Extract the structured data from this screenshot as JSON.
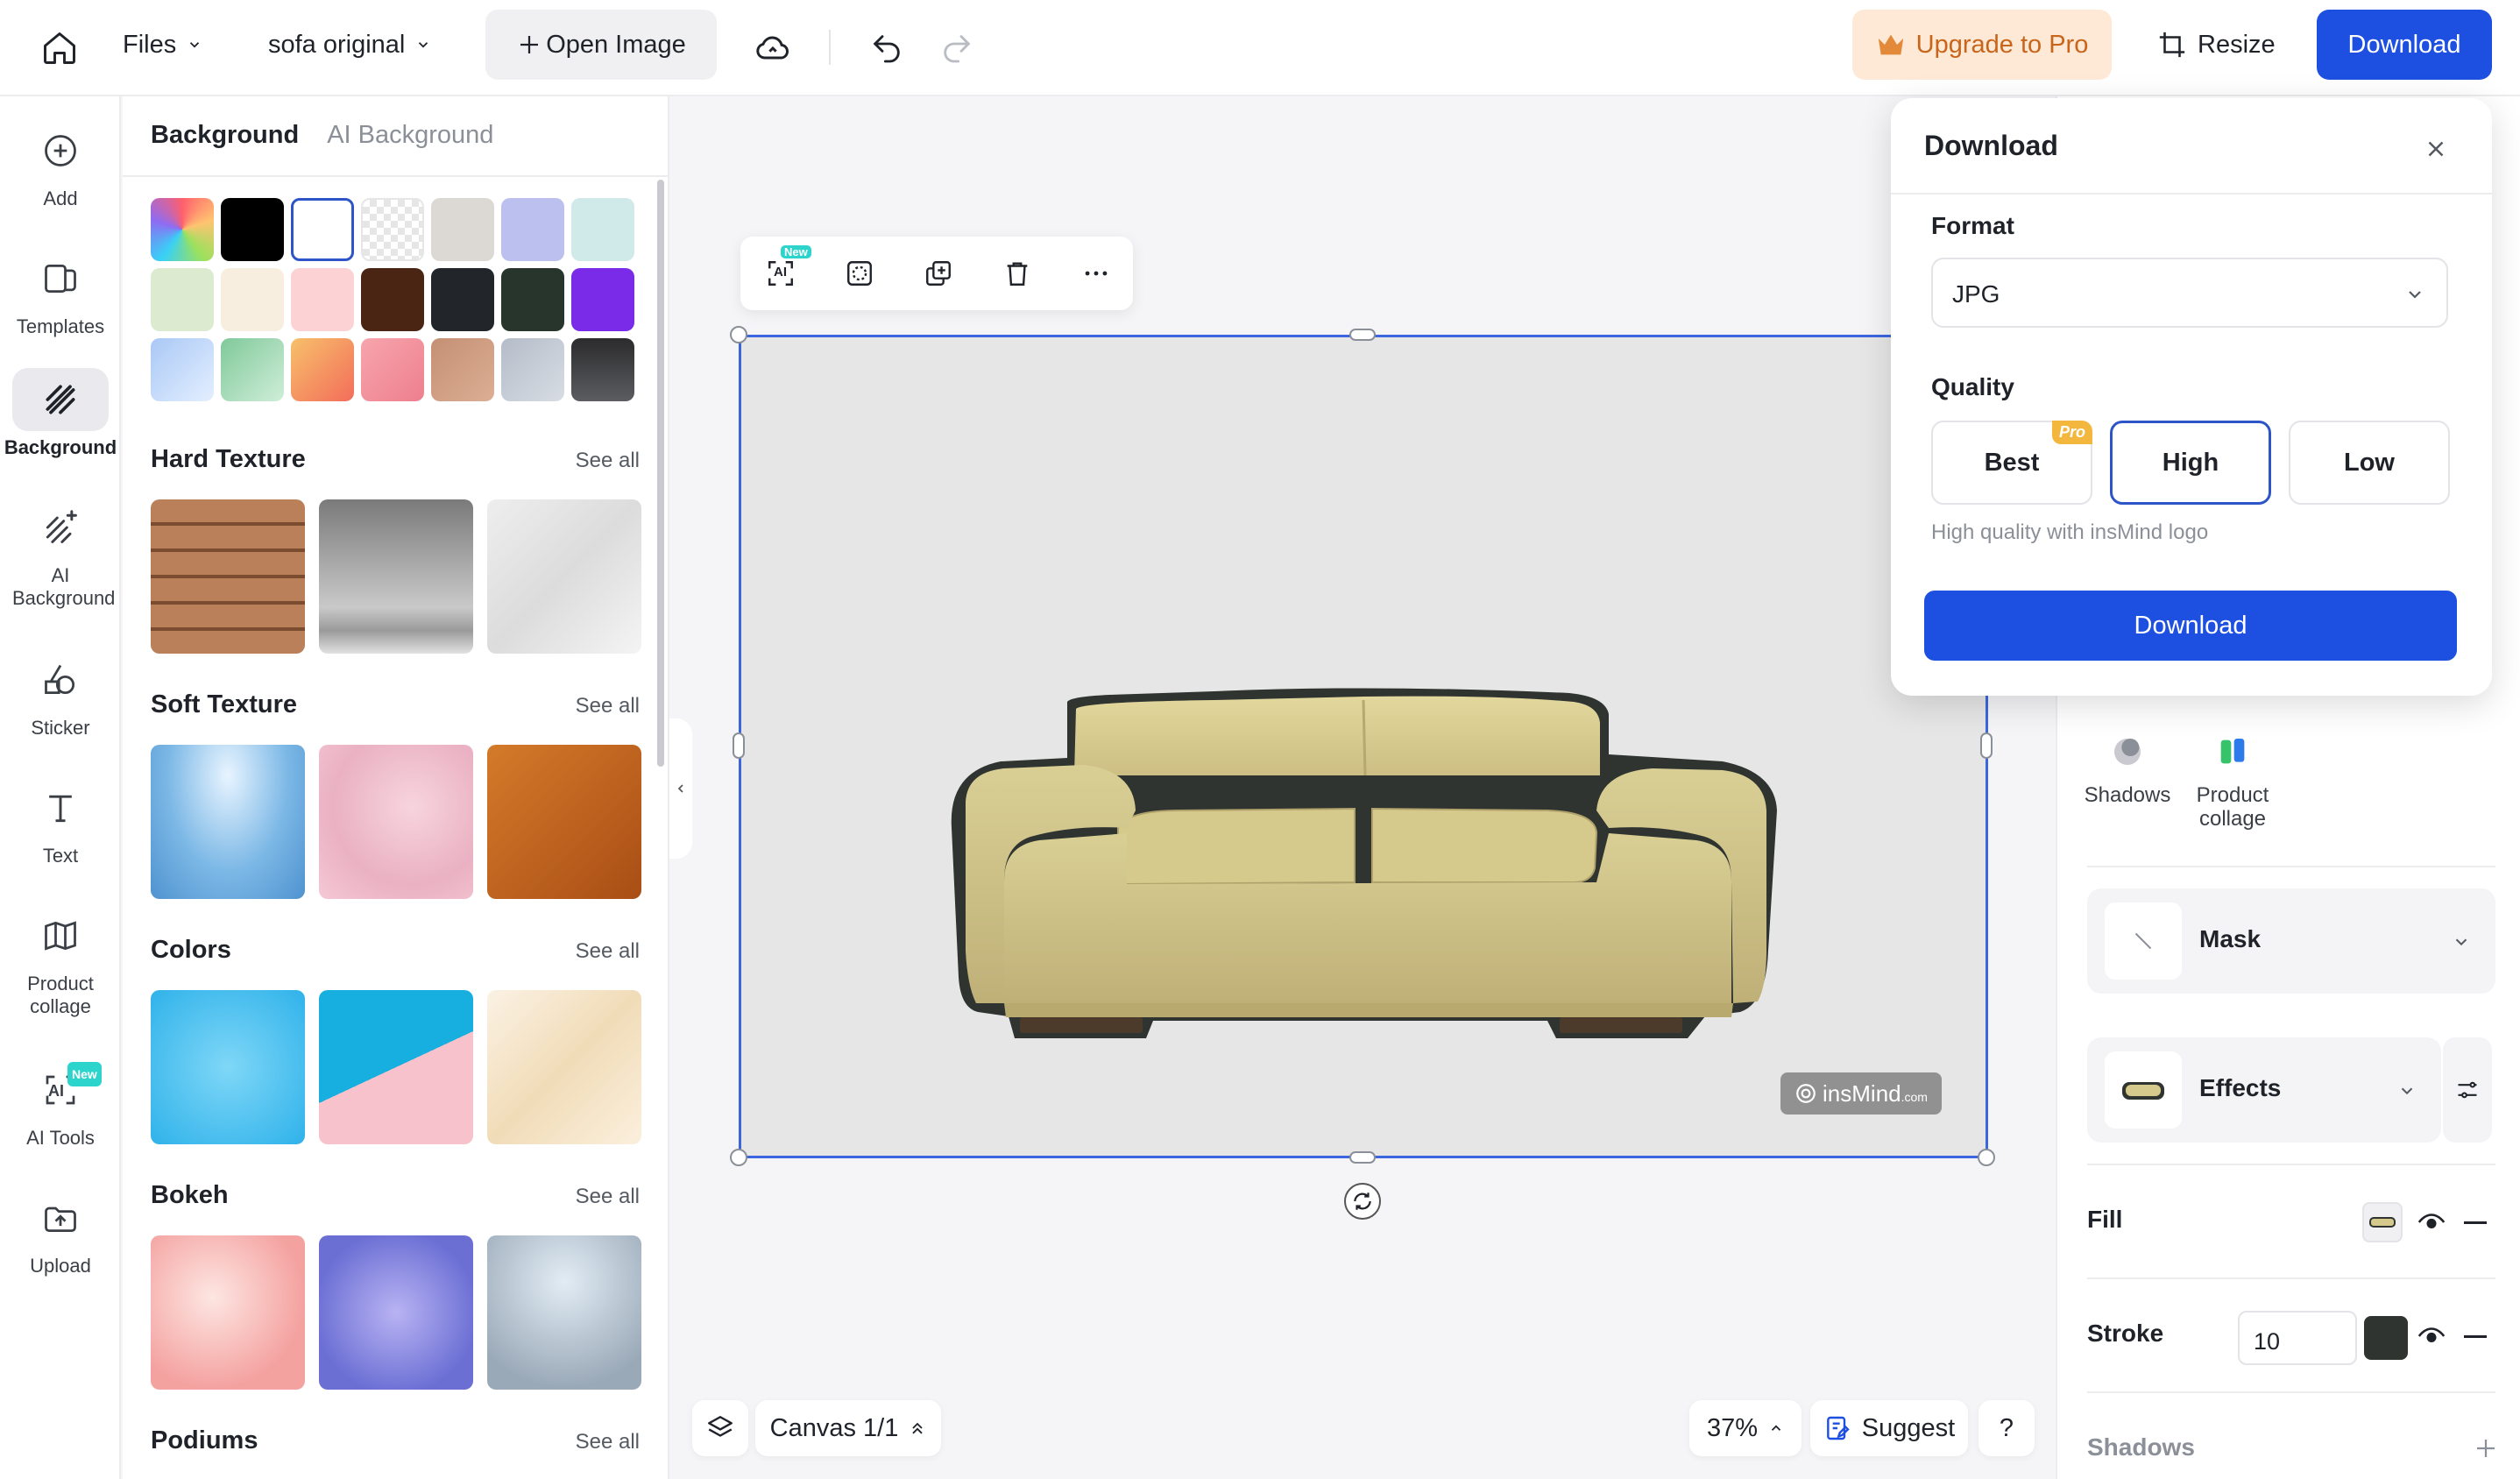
{
  "topbar": {
    "files_label": "Files",
    "project_name": "sofa original",
    "open_image_label": "Open Image",
    "upgrade_label": "Upgrade to Pro",
    "resize_label": "Resize",
    "download_label": "Download"
  },
  "rail": {
    "items": [
      {
        "label": "Add",
        "icon": "plus-circle-icon"
      },
      {
        "label": "Templates",
        "icon": "templates-icon"
      },
      {
        "label": "Background",
        "icon": "background-hatch-icon"
      },
      {
        "label": "AI Background",
        "icon": "ai-background-icon"
      },
      {
        "label": "Sticker",
        "icon": "sticker-icon"
      },
      {
        "label": "Text",
        "icon": "text-icon"
      },
      {
        "label": "Product collage",
        "icon": "product-collage-icon"
      },
      {
        "label": "AI Tools",
        "icon": "ai-tools-icon",
        "badge": "New"
      },
      {
        "label": "Upload",
        "icon": "upload-icon"
      }
    ]
  },
  "panel": {
    "tabs": [
      "Background",
      "AI Background"
    ],
    "see_all": "See all",
    "sections": [
      "Hard Texture",
      "Soft Texture",
      "Colors",
      "Bokeh",
      "Podiums"
    ]
  },
  "toolbar": {
    "ai_badge": "New",
    "ai_label": "AI"
  },
  "canvas": {
    "watermark": "insMind",
    "watermark_suffix": ".com"
  },
  "bottom": {
    "canvas_label": "Canvas 1/1",
    "zoom": "37%",
    "suggest_label": "Suggest",
    "help_label": "?"
  },
  "right_panel": {
    "shadows_tile": "Shadows",
    "collage_tile": "Product collage",
    "mask_label": "Mask",
    "effects_label": "Effects",
    "fill_label": "Fill",
    "stroke_label": "Stroke",
    "stroke_value": "10",
    "stroke_color": "#2f3430",
    "shadows_label": "Shadows"
  },
  "download_modal": {
    "title": "Download",
    "format_label": "Format",
    "format_value": "JPG",
    "quality_label": "Quality",
    "quality_options": [
      "Best",
      "High",
      "Low"
    ],
    "pro_badge": "Pro",
    "selected_quality": "High",
    "hint": "High quality with insMind logo",
    "download_button": "Download"
  },
  "colors": {
    "accent": "#1d4fe0",
    "upgrade_bg": "#fde9d5",
    "upgrade_text": "#c8651a",
    "pro_badge": "#f3b73d"
  }
}
